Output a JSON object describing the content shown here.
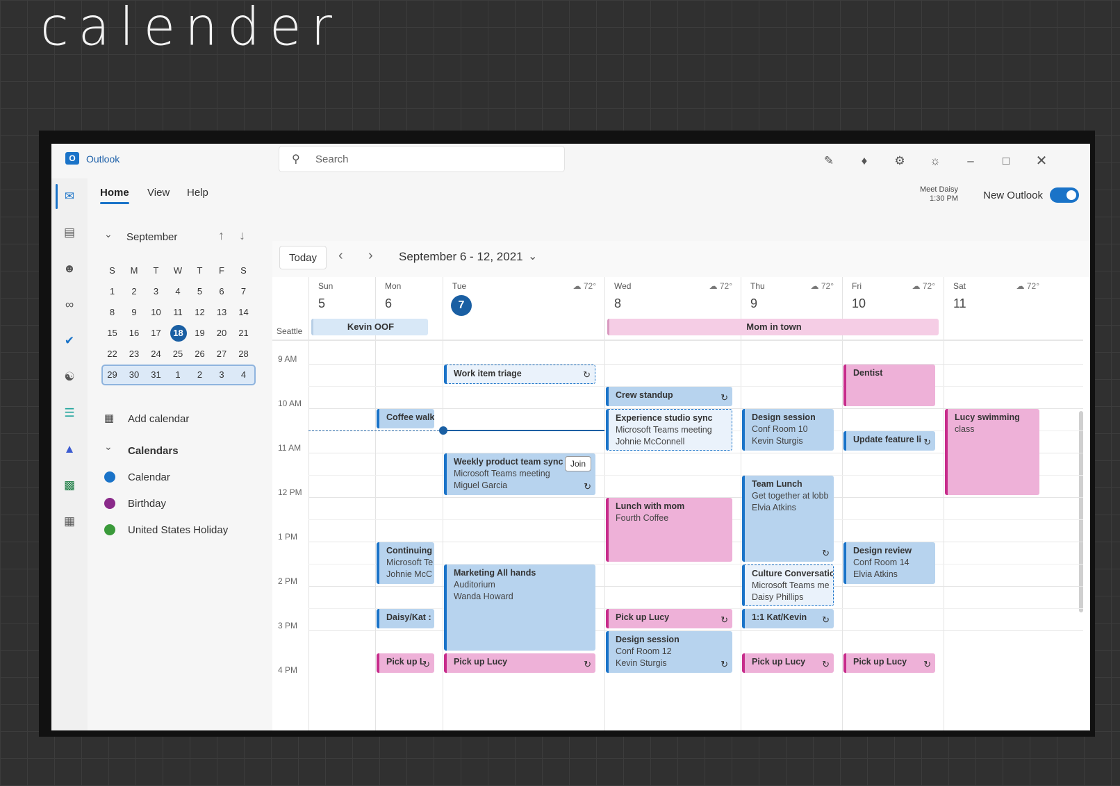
{
  "handwriting": "calender",
  "app": {
    "name": "Outlook",
    "logo": "O"
  },
  "search": {
    "placeholder": "Search",
    "icon": "search-icon"
  },
  "titlebar_icons": [
    "notes-icon",
    "bell-icon",
    "gear-icon",
    "lightbulb-icon",
    "minimize-icon",
    "maximize-icon",
    "close-icon"
  ],
  "ribbon": {
    "tabs": [
      "Home",
      "View",
      "Help"
    ],
    "meet_title": "Meet Daisy",
    "meet_time": "1:30 PM",
    "new_outlook": "New Outlook",
    "new_outlook_on": true
  },
  "rail_icons": [
    "mail-icon",
    "calendar-icon",
    "people-icon",
    "attach-icon",
    "todo-icon",
    "org-icon",
    "forms-icon",
    "teams-icon",
    "excel-icon",
    "apps-icon"
  ],
  "mini": {
    "month": "September",
    "weekdays": [
      "S",
      "M",
      "T",
      "W",
      "T",
      "F",
      "S"
    ],
    "weeks": [
      [
        "1",
        "2",
        "3",
        "4",
        "5",
        "6",
        "7"
      ],
      [
        "8",
        "9",
        "10",
        "11",
        "12",
        "13",
        "14"
      ],
      [
        "15",
        "16",
        "17",
        "18",
        "19",
        "20",
        "21"
      ],
      [
        "22",
        "23",
        "24",
        "25",
        "26",
        "27",
        "28"
      ],
      [
        "29",
        "30",
        "31",
        "1",
        "2",
        "3",
        "4"
      ]
    ],
    "today": "18",
    "selected_week_index": 2
  },
  "side": {
    "add_calendar": "Add calendar",
    "calendars_header": "Calendars",
    "calendars": [
      {
        "name": "Calendar",
        "color": "#1a73c8"
      },
      {
        "name": "Birthday",
        "color": "#8a2a8a"
      },
      {
        "name": "United States Holiday",
        "color": "#3a9a3a"
      }
    ]
  },
  "toolbar": {
    "today": "Today",
    "range": "September 6 - 12, 2021"
  },
  "days": [
    {
      "name": "Sun",
      "num": "5",
      "wx": ""
    },
    {
      "name": "Mon",
      "num": "6",
      "wx": ""
    },
    {
      "name": "Tue",
      "num": "7",
      "wx": "72°",
      "today": true
    },
    {
      "name": "Wed",
      "num": "8",
      "wx": "72°"
    },
    {
      "name": "Thu",
      "num": "9",
      "wx": "72°"
    },
    {
      "name": "Fri",
      "num": "10",
      "wx": "72°"
    },
    {
      "name": "Sat",
      "num": "11",
      "wx": "72°"
    }
  ],
  "timezone": "Seattle",
  "allday": [
    {
      "title": "Kevin OOF",
      "color": "blue"
    },
    {
      "title": "Mom in town",
      "color": "pink"
    }
  ],
  "hours": [
    "9 AM",
    "10 AM",
    "11 AM",
    "12 PM",
    "1 PM",
    "2 PM",
    "3 PM",
    "4 PM"
  ],
  "events": [
    {
      "day": 2,
      "start": 9.0,
      "end": 9.5,
      "style": "dash",
      "title": "Work item triage",
      "lines": [],
      "repeat": true
    },
    {
      "day": 5,
      "start": 9.0,
      "end": 10.0,
      "style": "pink",
      "title": "Dentist",
      "lines": []
    },
    {
      "day": 3,
      "start": 9.5,
      "end": 10.0,
      "style": "blue",
      "title": "Crew standup",
      "lines": [],
      "repeat": true
    },
    {
      "day": 1,
      "start": 10.0,
      "end": 10.5,
      "style": "blue",
      "title": "Coffee walk",
      "lines": []
    },
    {
      "day": 3,
      "start": 10.0,
      "end": 11.0,
      "style": "dash",
      "title": "Experience studio sync",
      "lines": [
        "Microsoft Teams meeting",
        "Johnie McConnell"
      ]
    },
    {
      "day": 4,
      "start": 10.0,
      "end": 11.0,
      "style": "blue",
      "title": "Design session",
      "lines": [
        "Conf Room 10",
        "Kevin Sturgis"
      ]
    },
    {
      "day": 5,
      "start": 10.5,
      "end": 11.0,
      "style": "blue",
      "title": "Update feature li",
      "lines": [],
      "repeat": true
    },
    {
      "day": 6,
      "start": 10.0,
      "end": 12.0,
      "style": "pink",
      "title": "Lucy swimming",
      "lines": [
        "class"
      ]
    },
    {
      "day": 2,
      "start": 11.0,
      "end": 12.0,
      "style": "blue",
      "title": "Weekly product team sync",
      "lines": [
        "Microsoft Teams meeting",
        "Miguel Garcia"
      ],
      "repeat": true,
      "join": "Join"
    },
    {
      "day": 4,
      "start": 11.5,
      "end": 13.5,
      "style": "blue",
      "title": "Team Lunch",
      "lines": [
        "Get together at lobb",
        "Elvia Atkins"
      ],
      "repeat": true
    },
    {
      "day": 3,
      "start": 12.0,
      "end": 13.5,
      "style": "pink",
      "title": "Lunch with mom",
      "lines": [
        "Fourth Coffee"
      ]
    },
    {
      "day": 1,
      "start": 13.0,
      "end": 14.0,
      "style": "blue",
      "title": "Continuing",
      "lines": [
        "Microsoft Te",
        "Johnie McC"
      ]
    },
    {
      "day": 5,
      "start": 13.0,
      "end": 14.0,
      "style": "blue",
      "title": "Design review",
      "lines": [
        "Conf Room 14",
        "Elvia Atkins"
      ]
    },
    {
      "day": 2,
      "start": 13.5,
      "end": 15.5,
      "style": "blue",
      "title": "Marketing All hands",
      "lines": [
        "Auditorium",
        "Wanda Howard"
      ]
    },
    {
      "day": 4,
      "start": 13.5,
      "end": 14.5,
      "style": "dash",
      "title": "Culture Conversatio",
      "lines": [
        "Microsoft Teams me",
        "Daisy Phillips"
      ]
    },
    {
      "day": 1,
      "start": 14.5,
      "end": 15.0,
      "style": "blue",
      "title": "Daisy/Kat :",
      "lines": []
    },
    {
      "day": 3,
      "start": 14.5,
      "end": 15.0,
      "style": "pink",
      "title": "Pick up Lucy",
      "lines": [],
      "repeat": true
    },
    {
      "day": 4,
      "start": 14.5,
      "end": 15.0,
      "style": "blue",
      "title": "1:1 Kat/Kevin",
      "lines": [],
      "repeat": true
    },
    {
      "day": 3,
      "start": 15.0,
      "end": 16.0,
      "style": "blue",
      "title": "Design session",
      "lines": [
        "Conf Room 12",
        "Kevin Sturgis"
      ],
      "repeat": true
    },
    {
      "day": 1,
      "start": 15.5,
      "end": 16.0,
      "style": "pink",
      "title": "Pick up L",
      "lines": [],
      "repeat": true
    },
    {
      "day": 2,
      "start": 15.5,
      "end": 16.0,
      "style": "pink",
      "title": "Pick up Lucy",
      "lines": [],
      "repeat": true
    },
    {
      "day": 4,
      "start": 15.5,
      "end": 16.0,
      "style": "pink",
      "title": "Pick up Lucy",
      "lines": [],
      "repeat": true
    },
    {
      "day": 5,
      "start": 15.5,
      "end": 16.0,
      "style": "pink",
      "title": "Pick up Lucy",
      "lines": [],
      "repeat": true
    }
  ],
  "current_time": 10.5
}
